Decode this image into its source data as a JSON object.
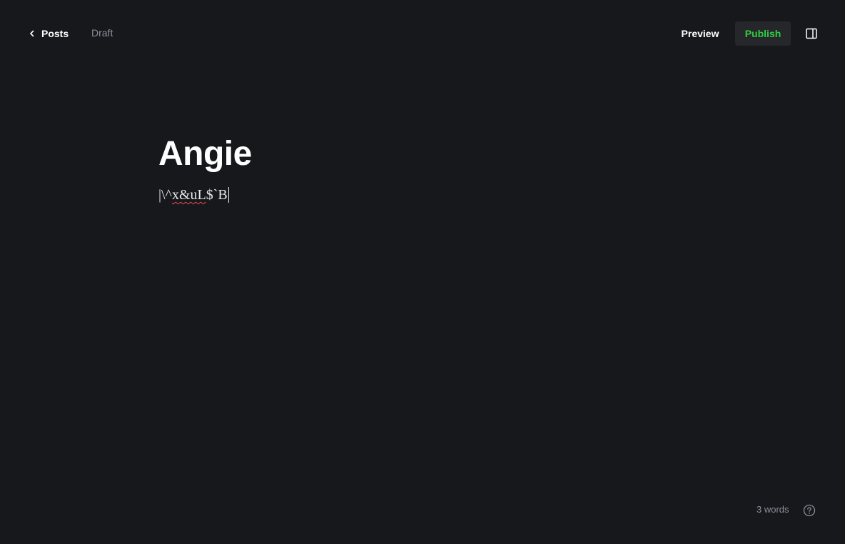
{
  "header": {
    "back_label": "Posts",
    "status": "Draft",
    "preview_label": "Preview",
    "publish_label": "Publish"
  },
  "post": {
    "title": "Angie",
    "body_prefix": "|\\^",
    "body_misspelled": "x&uL",
    "body_suffix": "$`B"
  },
  "footer": {
    "word_count": "3 words"
  },
  "colors": {
    "background": "#17181c",
    "publish_accent": "#30cf43",
    "muted_text": "#8b8f97",
    "spellcheck": "#e5484d"
  },
  "icons": {
    "back": "chevron-left-icon",
    "sidebar_toggle": "sidebar-toggle-icon",
    "help": "question-circle-icon"
  }
}
